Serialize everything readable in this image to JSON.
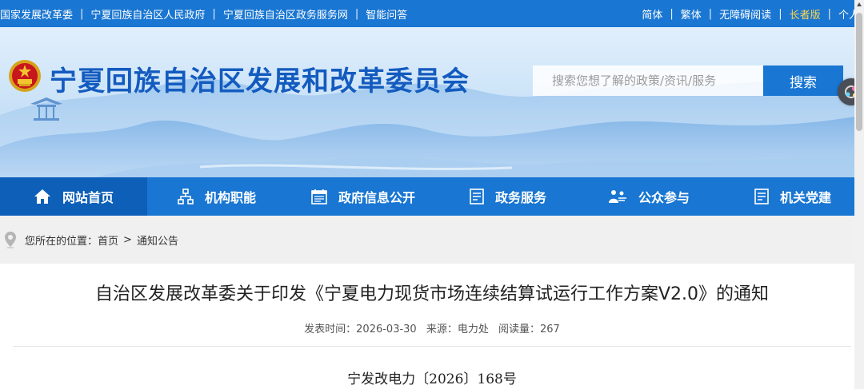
{
  "topbar": {
    "left_links": [
      "国家发展改革委",
      "宁夏回族自治区人民政府",
      "宁夏回族自治区政务服务网",
      "智能问答"
    ],
    "right_links": [
      "简体",
      "繁体",
      "无障碍阅读",
      "长者版",
      "个人"
    ],
    "highlight_color": "#ffd54a"
  },
  "header": {
    "site_title": "宁夏回族自治区发展和改革委员会",
    "search_placeholder": "搜索您想了解的政策/资讯/服务",
    "search_button": "搜索"
  },
  "nav": {
    "items": [
      {
        "label": "网站首页",
        "icon": "home-icon"
      },
      {
        "label": "机构职能",
        "icon": "org-chart-icon"
      },
      {
        "label": "政府信息公开",
        "icon": "calendar-icon"
      },
      {
        "label": "政务服务",
        "icon": "document-icon"
      },
      {
        "label": "公众参与",
        "icon": "people-icon"
      },
      {
        "label": "机关党建",
        "icon": "document-icon"
      }
    ],
    "active_index": 0
  },
  "breadcrumb": {
    "prefix": "您所在的位置：",
    "items": [
      "首页",
      "通知公告"
    ],
    "separator": ">"
  },
  "article": {
    "title": "自治区发展改革委关于印发《宁夏电力现货市场连续结算试运行工作方案V2.0》的通知",
    "publish_time": "发表时间：2026-03-30",
    "source": "来源：电力处",
    "views": "阅读量：267",
    "doc_number": "宁发改电力〔2026〕168号"
  },
  "colors": {
    "primary": "#1976d2",
    "nav_active": "#0d5fb8",
    "title_blue": "#135bbf"
  }
}
